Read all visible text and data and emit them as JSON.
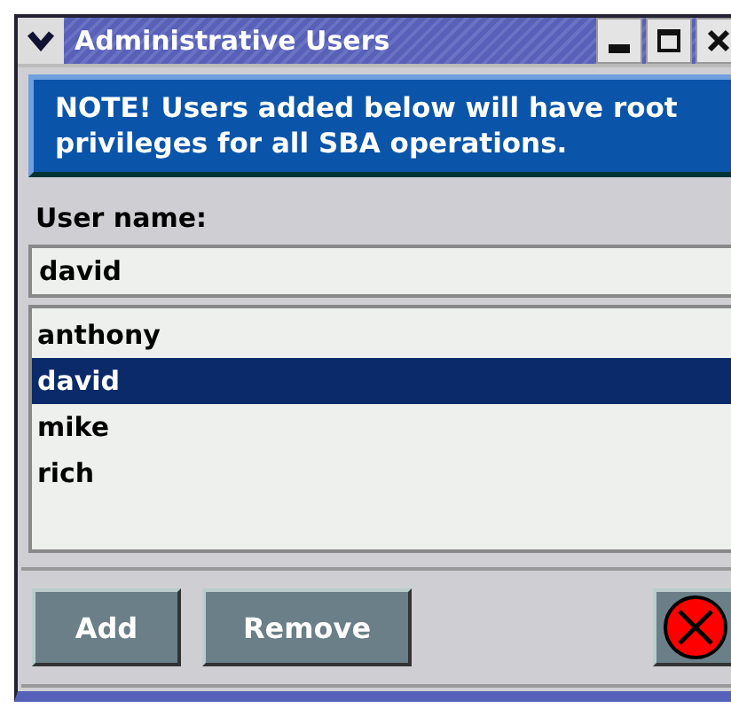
{
  "window": {
    "title": "Administrative Users"
  },
  "note": "NOTE! Users added below will have root privileges for all SBA operations.",
  "field": {
    "label": "User name:",
    "value": "david"
  },
  "users": [
    {
      "name": "anthony",
      "selected": false
    },
    {
      "name": "david",
      "selected": true
    },
    {
      "name": "mike",
      "selected": false
    },
    {
      "name": "rich",
      "selected": false
    }
  ],
  "buttons": [
    {
      "label": "Add",
      "kind": "text"
    },
    {
      "label": "Remove",
      "kind": "text"
    },
    {
      "kind": "close"
    }
  ]
}
